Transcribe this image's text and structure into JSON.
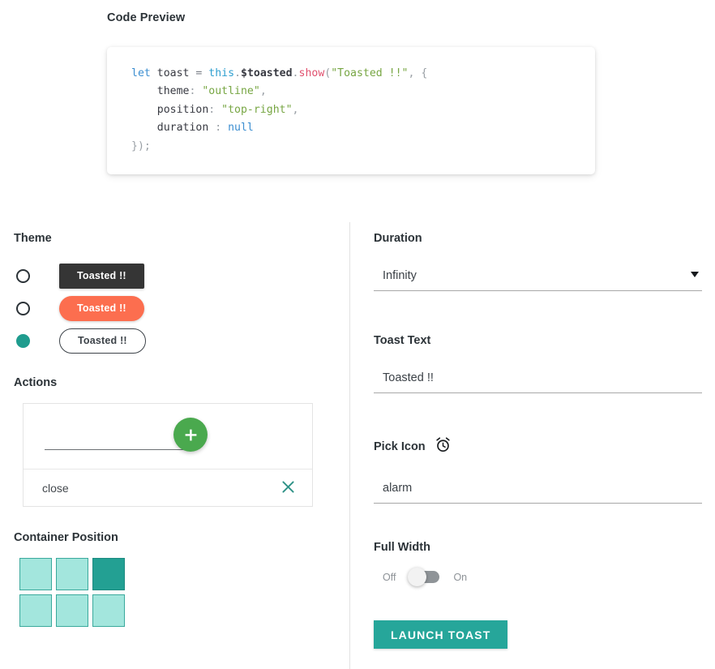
{
  "code_preview": {
    "title": "Code Preview",
    "lines": [
      {
        "tokens": [
          {
            "t": "let",
            "c": "k-kw"
          },
          {
            "t": " toast ",
            "c": "k-var"
          },
          {
            "t": "= ",
            "c": "k-op"
          },
          {
            "t": "this",
            "c": "k-this"
          },
          {
            "t": ".",
            "c": "k-punc"
          },
          {
            "t": "$toasted",
            "c": "k-prop"
          },
          {
            "t": ".",
            "c": "k-punc"
          },
          {
            "t": "show",
            "c": "k-fn"
          },
          {
            "t": "(",
            "c": "k-paren"
          },
          {
            "t": "\"Toasted !!\"",
            "c": "k-str"
          },
          {
            "t": ", ",
            "c": "k-punc"
          },
          {
            "t": "{",
            "c": "k-paren"
          }
        ]
      },
      {
        "tokens": [
          {
            "t": "    theme",
            "c": "k-key"
          },
          {
            "t": ": ",
            "c": "k-punc"
          },
          {
            "t": "\"outline\"",
            "c": "k-str"
          },
          {
            "t": ",",
            "c": "k-punc"
          }
        ]
      },
      {
        "tokens": [
          {
            "t": "    position",
            "c": "k-key"
          },
          {
            "t": ": ",
            "c": "k-punc"
          },
          {
            "t": "\"top-right\"",
            "c": "k-str"
          },
          {
            "t": ",",
            "c": "k-punc"
          }
        ]
      },
      {
        "tokens": [
          {
            "t": "    duration ",
            "c": "k-key"
          },
          {
            "t": ": ",
            "c": "k-punc"
          },
          {
            "t": "null",
            "c": "k-null"
          }
        ]
      },
      {
        "tokens": [
          {
            "t": "});",
            "c": "k-punc"
          }
        ]
      }
    ]
  },
  "theme": {
    "title": "Theme",
    "options": [
      {
        "label": "Toasted !!",
        "style": "primary",
        "selected": false
      },
      {
        "label": "Toasted !!",
        "style": "bubble",
        "selected": false
      },
      {
        "label": "Toasted !!",
        "style": "outline",
        "selected": true
      }
    ]
  },
  "actions": {
    "title": "Actions",
    "new_action_value": "",
    "new_action_placeholder": "",
    "add_button_label": "+",
    "items": [
      {
        "label": "close",
        "remove_label": "×"
      }
    ]
  },
  "container_position": {
    "title": "Container Position",
    "cells": [
      {
        "name": "top-left",
        "selected": false
      },
      {
        "name": "top-center",
        "selected": false
      },
      {
        "name": "top-right",
        "selected": true
      },
      {
        "name": "bottom-left",
        "selected": false
      },
      {
        "name": "bottom-center",
        "selected": false
      },
      {
        "name": "bottom-right",
        "selected": false
      }
    ]
  },
  "duration": {
    "title": "Duration",
    "value": "Infinity"
  },
  "toast_text": {
    "title": "Toast Text",
    "value": "Toasted !!",
    "placeholder": ""
  },
  "pick_icon": {
    "title": "Pick Icon",
    "icon": "alarm-clock-icon",
    "value": "alarm",
    "placeholder": ""
  },
  "full_width": {
    "title": "Full Width",
    "off_label": "Off",
    "on_label": "On",
    "state": "off"
  },
  "launch": {
    "label": "LAUNCH TOAST"
  },
  "colors": {
    "teal": "#26a69a",
    "teal_dark": "#1f9c8e",
    "teal_light": "#a3e6dd",
    "green": "#4aa94e",
    "orange": "#fc6e4f",
    "dark": "#353535"
  }
}
